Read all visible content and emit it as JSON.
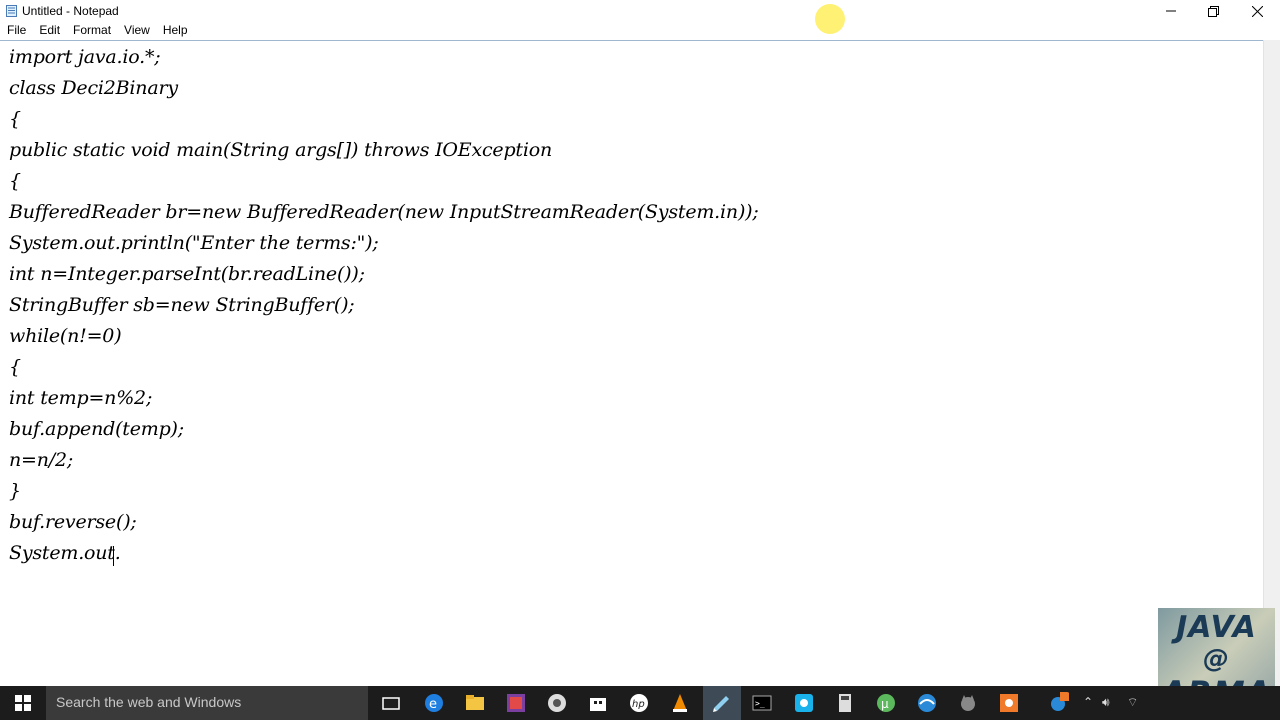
{
  "window": {
    "title": "Untitled - Notepad"
  },
  "menu": [
    "File",
    "Edit",
    "Format",
    "View",
    "Help"
  ],
  "editor": {
    "lines": [
      "import java.io.*;",
      "class Deci2Binary",
      "{",
      "public static void main(String args[]) throws IOException",
      "{",
      "BufferedReader br=new BufferedReader(new InputStreamReader(System.in));",
      "System.out.println(\"Enter the terms:\");",
      "int n=Integer.parseInt(br.readLine());",
      "StringBuffer sb=new StringBuffer();",
      "while(n!=0)",
      "{",
      "int temp=n%2;",
      "buf.append(temp);",
      "n=n/2;",
      "}",
      "buf.reverse();",
      "System.out."
    ]
  },
  "watermark": {
    "line1": "JAVA",
    "line2": "@",
    "line3": "ARMA"
  },
  "taskbar": {
    "search_placeholder": "Search the web and Windows",
    "icons": [
      "task-view-icon",
      "edge-icon",
      "file-explorer-icon",
      "app-icon",
      "chrome-icon",
      "store-icon",
      "hp-icon",
      "vlc-icon",
      "notepad-icon",
      "cmd-icon",
      "skype-icon",
      "calculator-icon",
      "utorrent-icon",
      "browser-icon",
      "cat-icon",
      "orange-app-icon"
    ]
  },
  "colors": {
    "taskbar": "#1c1c1c",
    "search": "#3a3a3a",
    "cursor_highlight": "#ffef5a"
  }
}
